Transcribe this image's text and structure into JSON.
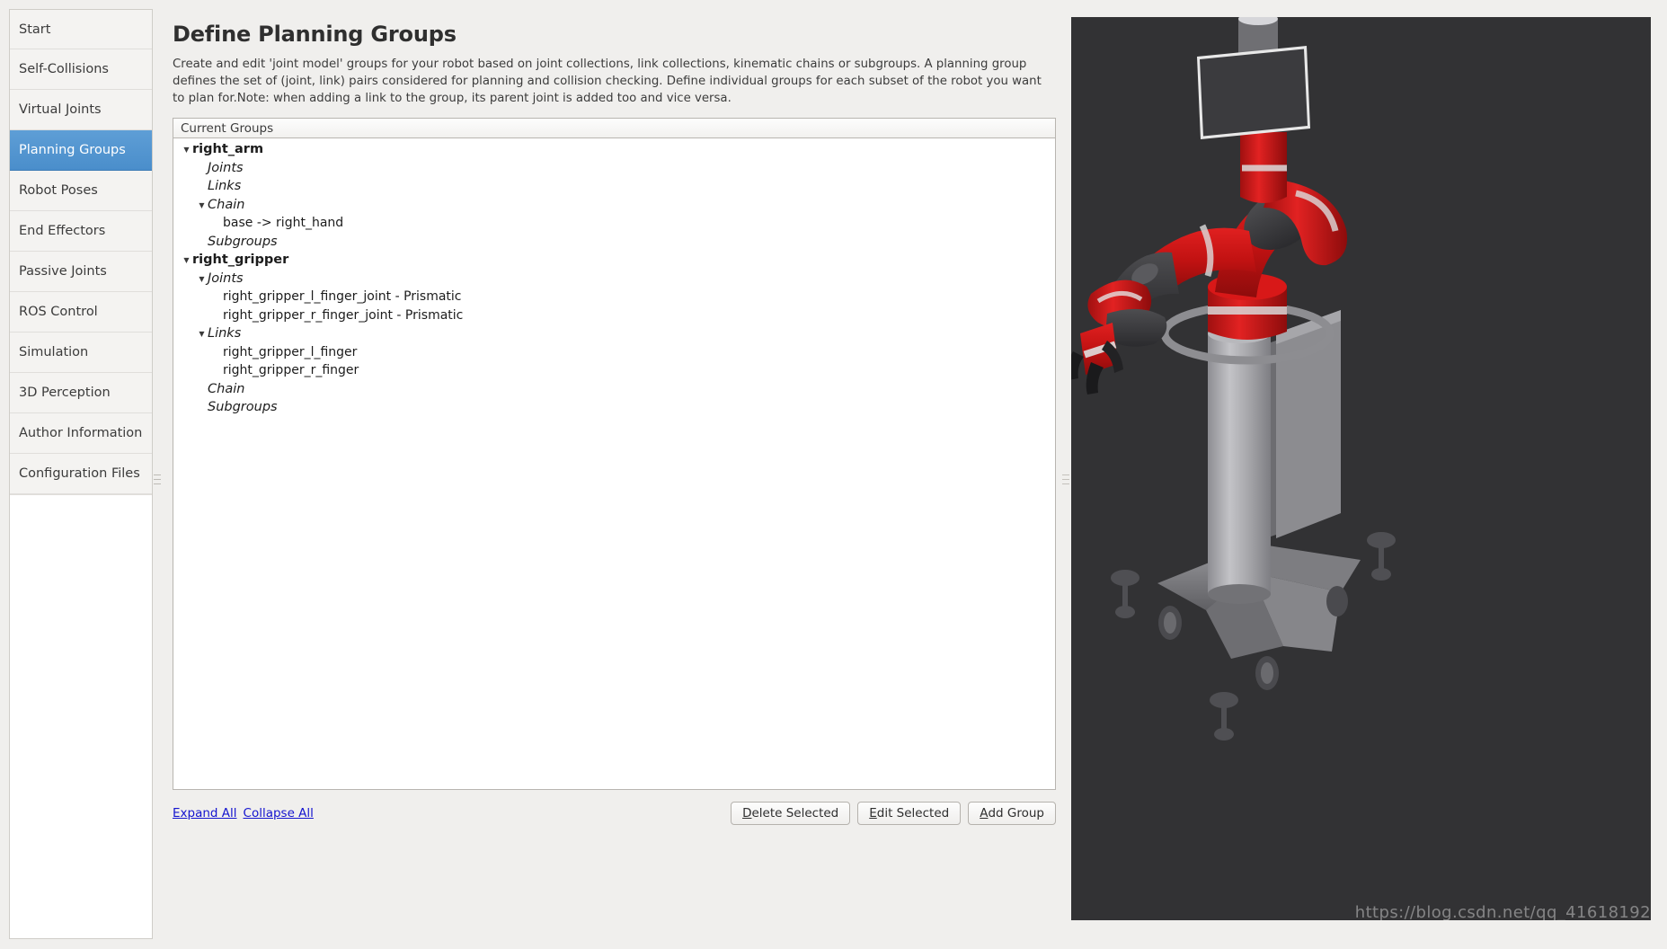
{
  "sidebar": {
    "items": [
      {
        "label": "Start",
        "selected": false
      },
      {
        "label": "Self-Collisions",
        "selected": false
      },
      {
        "label": "Virtual Joints",
        "selected": false
      },
      {
        "label": "Planning Groups",
        "selected": true
      },
      {
        "label": "Robot Poses",
        "selected": false
      },
      {
        "label": "End Effectors",
        "selected": false
      },
      {
        "label": "Passive Joints",
        "selected": false
      },
      {
        "label": "ROS Control",
        "selected": false
      },
      {
        "label": "Simulation",
        "selected": false
      },
      {
        "label": "3D Perception",
        "selected": false
      },
      {
        "label": "Author Information",
        "selected": false
      },
      {
        "label": "Configuration Files",
        "selected": false
      }
    ]
  },
  "main": {
    "title": "Define Planning Groups",
    "description": "Create and edit 'joint model' groups for your robot based on joint collections, link collections, kinematic chains or subgroups. A planning group defines the set of (joint, link) pairs considered for planning and collision checking. Define individual groups for each subset of the robot you want to plan for.Note: when adding a link to the group, its parent joint is added too and vice versa.",
    "tree_header": "Current Groups",
    "tree": [
      {
        "label": "right_arm",
        "level": 0,
        "arrow": "down",
        "style": "bold"
      },
      {
        "label": "Joints",
        "level": 1,
        "arrow": "none",
        "style": "italic"
      },
      {
        "label": "Links",
        "level": 1,
        "arrow": "none",
        "style": "italic"
      },
      {
        "label": "Chain",
        "level": 1,
        "arrow": "down",
        "style": "italic"
      },
      {
        "label": "base  ->  right_hand",
        "level": 2,
        "arrow": "none",
        "style": "plain"
      },
      {
        "label": "Subgroups",
        "level": 1,
        "arrow": "none",
        "style": "italic"
      },
      {
        "label": "right_gripper",
        "level": 0,
        "arrow": "down",
        "style": "bold"
      },
      {
        "label": "Joints",
        "level": 1,
        "arrow": "down",
        "style": "italic"
      },
      {
        "label": "right_gripper_l_finger_joint - Prismatic",
        "level": 2,
        "arrow": "none",
        "style": "plain"
      },
      {
        "label": "right_gripper_r_finger_joint - Prismatic",
        "level": 2,
        "arrow": "none",
        "style": "plain"
      },
      {
        "label": "Links",
        "level": 1,
        "arrow": "down",
        "style": "italic"
      },
      {
        "label": "right_gripper_l_finger",
        "level": 2,
        "arrow": "none",
        "style": "plain"
      },
      {
        "label": "right_gripper_r_finger",
        "level": 2,
        "arrow": "none",
        "style": "plain"
      },
      {
        "label": "Chain",
        "level": 1,
        "arrow": "none",
        "style": "italic"
      },
      {
        "label": "Subgroups",
        "level": 1,
        "arrow": "none",
        "style": "italic"
      }
    ],
    "links": [
      {
        "label": "Expand All"
      },
      {
        "label": "Collapse All"
      }
    ],
    "buttons": [
      {
        "mnemonic": "D",
        "rest": "elete Selected"
      },
      {
        "mnemonic": "E",
        "rest": "dit Selected"
      },
      {
        "mnemonic": "A",
        "rest": "dd Group"
      }
    ]
  },
  "viewport": {
    "watermark": "https://blog.csdn.net/qq_41618192",
    "background_color": "#323234",
    "robot_accent_color": "#cc1414",
    "robot_dark_color": "#3a3a3c",
    "robot_metal_color": "#a8a8ac"
  },
  "theme": {
    "accent": "#5294d0",
    "page_background": "#f0efed",
    "panel_background": "#ffffff",
    "link_color": "#1414cf"
  }
}
